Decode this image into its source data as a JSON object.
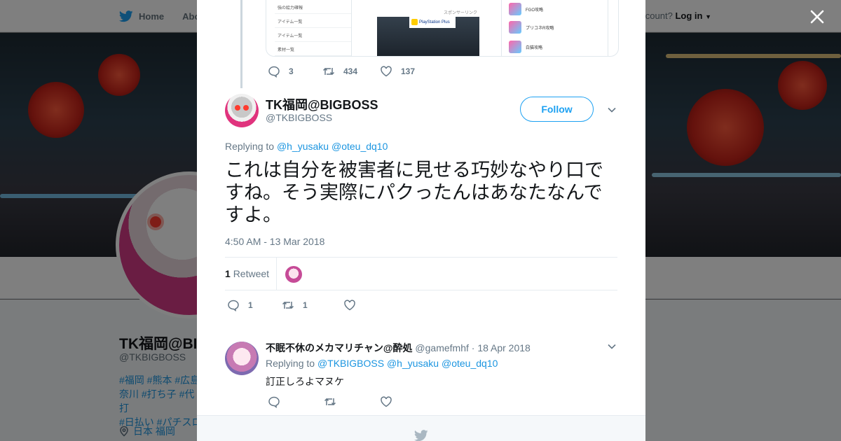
{
  "topbar": {
    "home_label": "Home",
    "about_label": "Abo",
    "account_prompt": "ccount?",
    "login_label": "Log in"
  },
  "background_profile": {
    "name": "TK福岡@BI",
    "handle": "@TKBIGBOSS",
    "tags": [
      "#福岡 #熊本 #広島",
      "奈川 #打ち子 #代打",
      "#日払い #パチスロ"
    ],
    "location": "日本 福岡"
  },
  "quoted_card": {
    "menu_items": [
      "強の絵力確報",
      "アイテム一覧",
      "アイテム一覧",
      "素材一覧"
    ],
    "sponsor_label": "スポンサーリンク",
    "ad_label": "PlayStation Plus",
    "side_items": [
      "FGO攻略",
      "プリコネR攻略",
      "白猫攻略"
    ]
  },
  "parent_tweet_actions": {
    "replies": "3",
    "retweets": "434",
    "likes": "137"
  },
  "main_tweet": {
    "author_name": "TK福岡@BIGBOSS",
    "author_handle": "@TKBIGBOSS",
    "follow_label": "Follow",
    "replying_label": "Replying to",
    "mentions": [
      "@h_yusaku",
      "@oteu_dq10"
    ],
    "text": "これは自分を被害者に見せる巧妙なやり口ですね。そう実際にパクったんはあなたなんですよ。",
    "timestamp": "4:50 AM - 13 Mar 2018",
    "retweet_count": "1",
    "retweet_label": "Retweet",
    "actions": {
      "replies": "1",
      "retweets": "1",
      "likes": ""
    }
  },
  "reply_tweet": {
    "author_name": "不眠不休のメカマリチャン@酔処",
    "author_handle": "@gamefmhf",
    "date": "· 18 Apr 2018",
    "replying_label": "Replying to",
    "mentions": [
      "@TKBIGBOSS",
      "@h_yusaku",
      "@oteu_dq10"
    ],
    "text": "訂正しろよマヌケ"
  },
  "colors": {
    "accent": "#1da1f2",
    "link": "#1b95e0",
    "muted": "#657786"
  }
}
